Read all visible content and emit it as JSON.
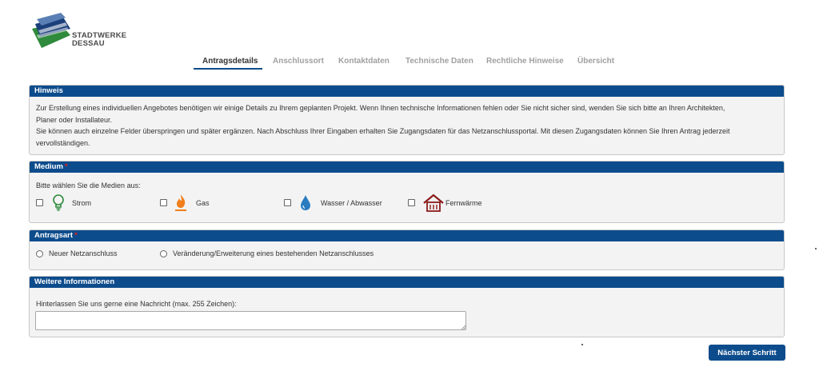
{
  "brand": {
    "line1": "STADTWERKE",
    "line2": "DESSAU",
    "colors": {
      "blue": "#0d4c8c",
      "green": "#2f8a3c",
      "navy": "#1b3f7a"
    }
  },
  "tabs": [
    {
      "label": "Antragsdetails",
      "active": true
    },
    {
      "label": "Anschlussort",
      "active": false
    },
    {
      "label": "Kontaktdaten",
      "active": false
    },
    {
      "label": "Technische Daten",
      "active": false
    },
    {
      "label": "Rechtliche Hinweise",
      "active": false
    },
    {
      "label": "Übersicht",
      "active": false
    }
  ],
  "hinweis": {
    "title": "Hinweis",
    "lines": [
      "Zur Erstellung eines individuellen Angebotes benötigen wir einige Details zu Ihrem geplanten Projekt. Wenn Ihnen technische Informationen fehlen oder Sie nicht sicher sind, wenden Sie sich bitte an Ihren Architekten,",
      "Planer oder Installateur.",
      "Sie können auch einzelne Felder überspringen und später ergänzen. Nach Abschluss Ihrer Eingaben erhalten Sie Zugangsdaten für das Netzanschlussportal. Mit diesen Zugangsdaten können Sie Ihren Antrag jederzeit",
      "vervollständigen."
    ]
  },
  "medium": {
    "title": "Medium",
    "required_mark": "*",
    "intro": "Bitte wählen Sie die Medien aus:",
    "options": [
      {
        "label": "Strom",
        "icon": "lightbulb-icon",
        "checked": false
      },
      {
        "label": "Gas",
        "icon": "flame-icon",
        "checked": false
      },
      {
        "label": "Wasser / Abwasser",
        "icon": "water-drop-icon",
        "checked": false
      },
      {
        "label": "Fernwärme",
        "icon": "district-heating-icon",
        "checked": false
      }
    ]
  },
  "antragsart": {
    "title": "Antragsart",
    "required_mark": "*",
    "options": [
      {
        "label": "Neuer Netzanschluss",
        "selected": false
      },
      {
        "label": "Veränderung/Erweiterung eines bestehenden Netzanschlusses",
        "selected": false
      }
    ]
  },
  "weitere": {
    "title": "Weitere Informationen",
    "label": "Hinterlassen Sie uns gerne eine Nachricht (max. 255 Zeichen):",
    "value": ""
  },
  "actions": {
    "next_label": "Nächster Schritt"
  }
}
